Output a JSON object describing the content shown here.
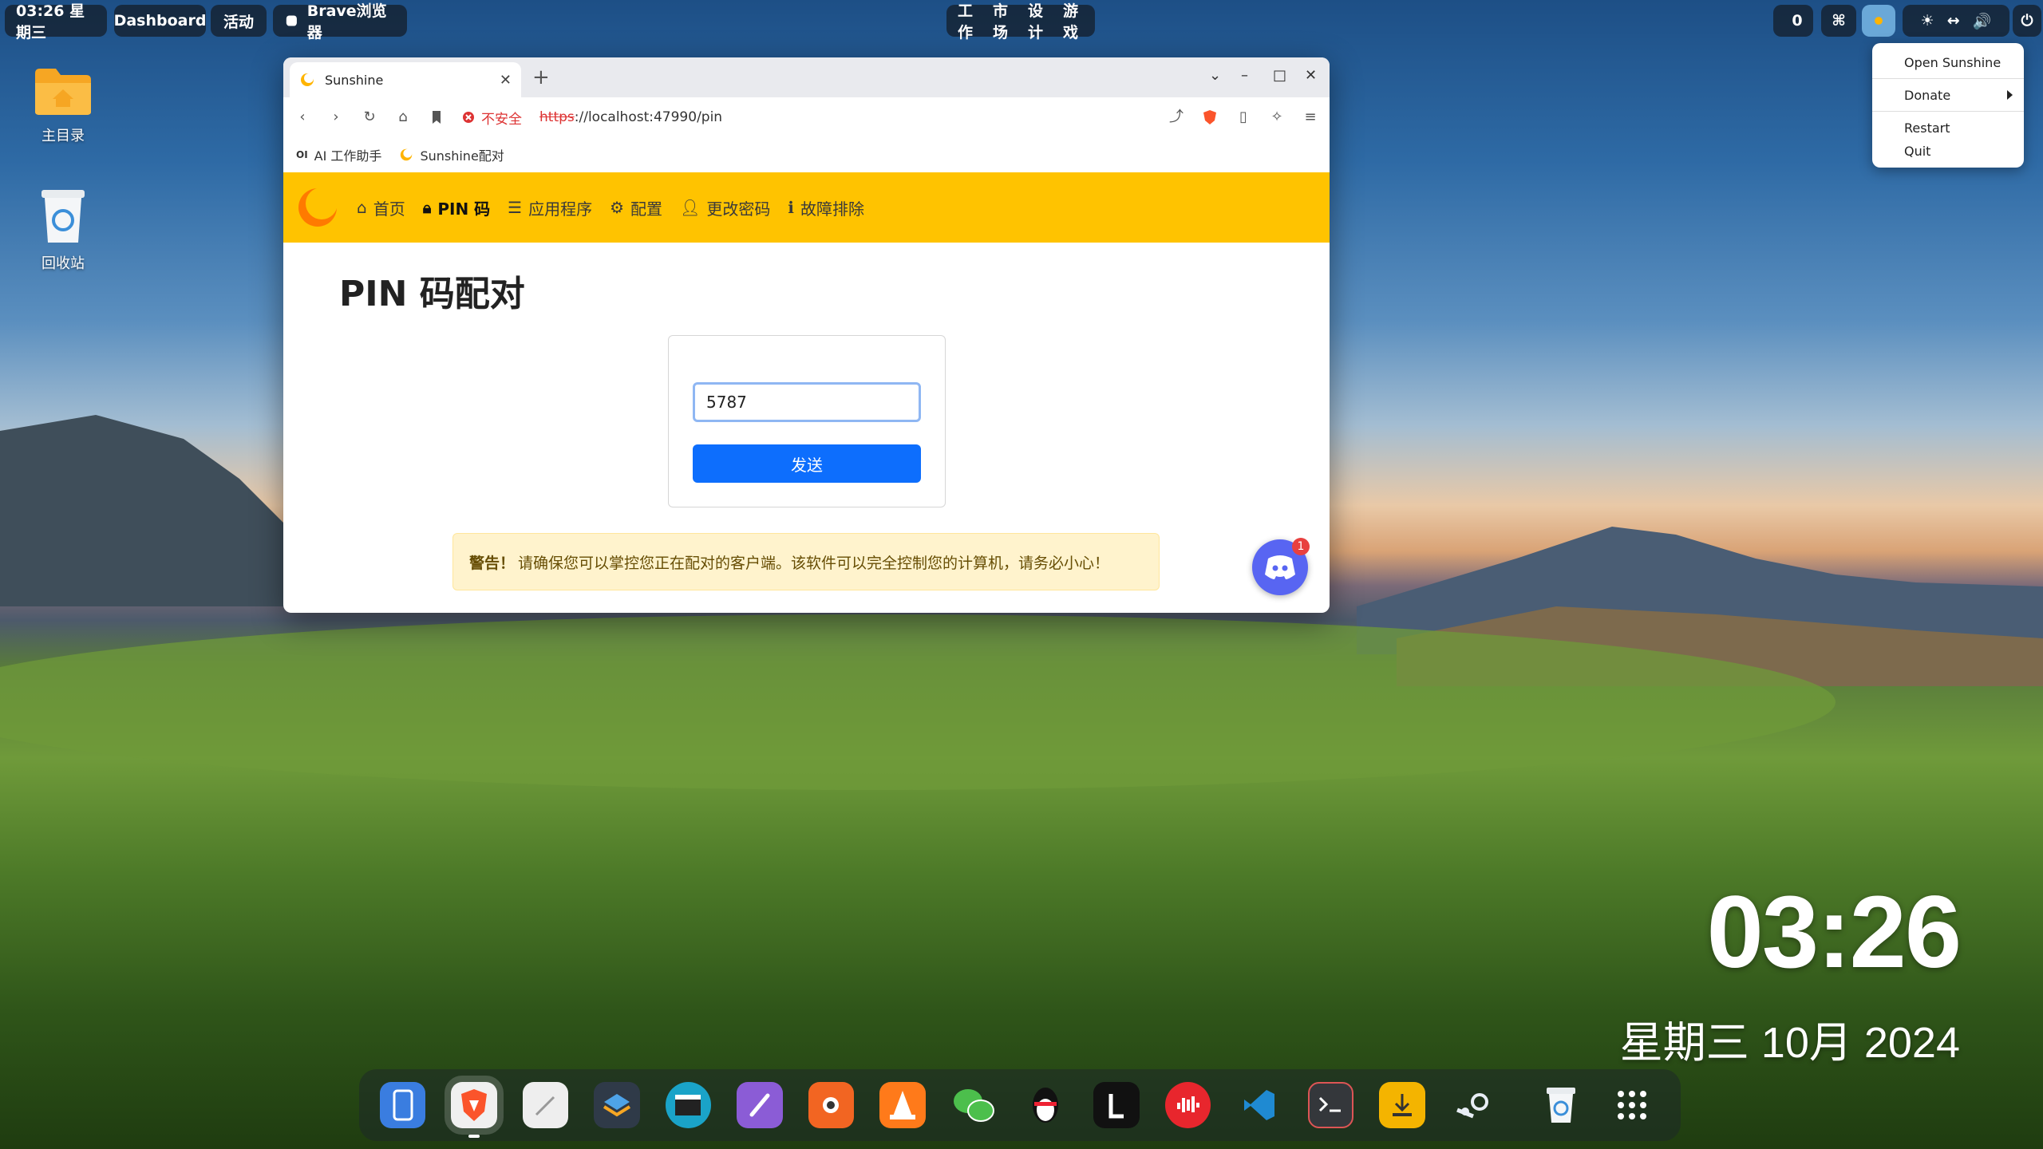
{
  "topbar": {
    "clock_label": "03:26 星期三",
    "dashboard_label": "Dashboard",
    "activities_label": "活动",
    "app_label": "Brave浏览器",
    "workspaces": [
      "工作",
      "市场",
      "设计",
      "游戏"
    ],
    "notification_count": "0"
  },
  "tray_menu": {
    "items": [
      "Open Sunshine",
      "Donate",
      "Restart",
      "Quit"
    ]
  },
  "desktop": {
    "icons": [
      {
        "label": "主目录",
        "icon": "home-folder-icon"
      },
      {
        "label": "回收站",
        "icon": "trash-icon"
      }
    ]
  },
  "browser": {
    "tab_title": "Sunshine",
    "security_label": "不安全",
    "url_protocol": "https",
    "url_rest": "://localhost:47990/pin",
    "bookmarks": [
      "AI 工作助手",
      "Sunshine配对"
    ]
  },
  "sunshine": {
    "nav": [
      "首页",
      "PIN 码",
      "应用程序",
      "配置",
      "更改密码",
      "故障排除"
    ],
    "page_title": "PIN 码配对",
    "pin_value": "5787",
    "send_label": "发送",
    "warning_strong": "警告！",
    "warning_text": "请确保您可以掌控您正在配对的客户端。该软件可以完全控制您的计算机，请务必小心！",
    "discord_badge": "1"
  },
  "desktop_clock": {
    "time": "03:26",
    "date": "星期三 10月 2024"
  },
  "dock": {
    "apps": [
      "files-icon",
      "brave-icon",
      "text-editor-icon",
      "layers-icon",
      "video-editor-icon",
      "paint-icon",
      "screenshot-icon",
      "vlc-icon",
      "wechat-icon",
      "qq-icon",
      "lark-icon",
      "music-icon",
      "vscode-icon",
      "terminal-icon",
      "installer-icon",
      "steam-icon",
      "trash-icon",
      "app-grid-icon"
    ]
  },
  "colors": {
    "sunshine_yellow": "#ffc300",
    "primary_blue": "#0d6efd",
    "warning_bg": "#fff3cd",
    "discord": "#5865f2"
  }
}
